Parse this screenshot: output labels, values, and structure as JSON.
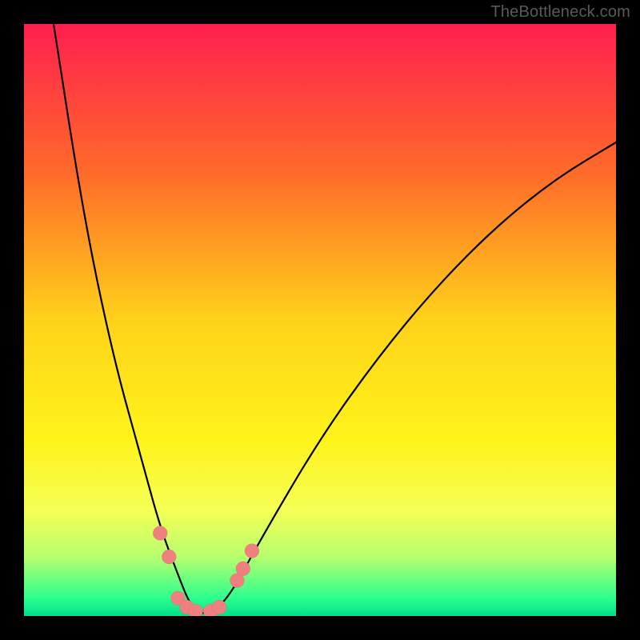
{
  "watermark": "TheBottleneck.com",
  "chart_data": {
    "type": "line",
    "title": "",
    "xlabel": "",
    "ylabel": "",
    "xlim": [
      0,
      100
    ],
    "ylim": [
      0,
      100
    ],
    "gradient_stops": [
      {
        "pos": 0.0,
        "color": "#ff1f4f"
      },
      {
        "pos": 0.25,
        "color": "#ff6a2a"
      },
      {
        "pos": 0.5,
        "color": "#ffd21a"
      },
      {
        "pos": 0.7,
        "color": "#fff31a"
      },
      {
        "pos": 0.82,
        "color": "#f5ff55"
      },
      {
        "pos": 0.9,
        "color": "#b7ff6e"
      },
      {
        "pos": 0.97,
        "color": "#2cff8e"
      },
      {
        "pos": 1.0,
        "color": "#00e08a"
      }
    ],
    "curve": {
      "minimum_x": 30,
      "left_branch": [
        {
          "x": 5,
          "y": 100
        },
        {
          "x": 10,
          "y": 68
        },
        {
          "x": 15,
          "y": 44
        },
        {
          "x": 20,
          "y": 26
        },
        {
          "x": 23,
          "y": 15
        },
        {
          "x": 26,
          "y": 7
        },
        {
          "x": 28,
          "y": 2
        },
        {
          "x": 30,
          "y": 0
        }
      ],
      "right_branch": [
        {
          "x": 30,
          "y": 0
        },
        {
          "x": 34,
          "y": 2
        },
        {
          "x": 40,
          "y": 13
        },
        {
          "x": 50,
          "y": 30
        },
        {
          "x": 60,
          "y": 44
        },
        {
          "x": 70,
          "y": 56
        },
        {
          "x": 80,
          "y": 66
        },
        {
          "x": 90,
          "y": 74
        },
        {
          "x": 100,
          "y": 80
        }
      ]
    },
    "markers": {
      "color": "#f08080",
      "radius_px": 9,
      "points": [
        {
          "x": 23,
          "y": 14
        },
        {
          "x": 24.5,
          "y": 10
        },
        {
          "x": 26,
          "y": 3
        },
        {
          "x": 27.5,
          "y": 1.5
        },
        {
          "x": 29,
          "y": 0.8
        },
        {
          "x": 31.5,
          "y": 0.8
        },
        {
          "x": 33,
          "y": 1.5
        },
        {
          "x": 36,
          "y": 6
        },
        {
          "x": 37,
          "y": 8
        },
        {
          "x": 38.5,
          "y": 11
        }
      ]
    }
  }
}
